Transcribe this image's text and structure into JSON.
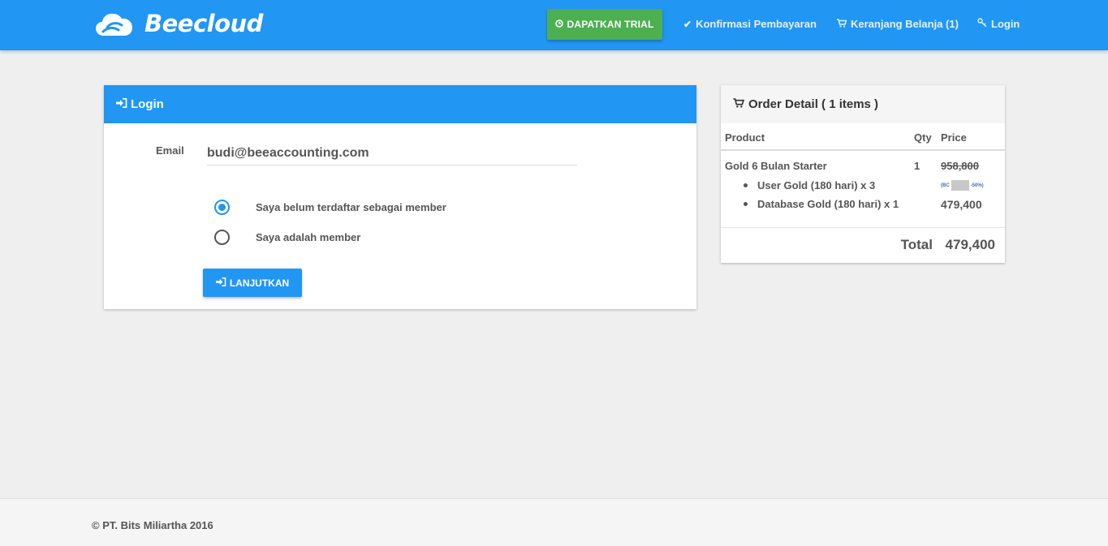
{
  "brand": {
    "name": "Beecloud"
  },
  "nav": {
    "trial_label": "DAPATKAN TRIAL",
    "confirm_label": "Konfirmasi Pembayaran",
    "cart_label": "Keranjang Belanja (1)",
    "login_label": "Login"
  },
  "login": {
    "title": "Login",
    "email_label": "Email",
    "email_value": "budi@beeaccounting.com",
    "radio_new": "Saya belum terdaftar sebagai member",
    "radio_member": "Saya adalah member",
    "selected": "new",
    "button_label": "LANJUTKAN"
  },
  "order": {
    "title": "Order Detail ( 1 items )",
    "col_product": "Product",
    "col_qty": "Qty",
    "col_price": "Price",
    "product_name": "Gold 6 Bulan Starter",
    "qty": "1",
    "old_price": "958,800",
    "discount_prefix": "(BC",
    "discount_suffix": "-50%)",
    "items": [
      "User Gold (180 hari) x 3",
      "Database Gold (180 hari) x 1"
    ],
    "new_price": "479,400",
    "total_label": "Total",
    "total_value": "479,400"
  },
  "footer": {
    "text": "© PT. Bits Miliartha 2016"
  },
  "colors": {
    "primary": "#2196f3",
    "success": "#4caf50",
    "background": "#efefef"
  }
}
